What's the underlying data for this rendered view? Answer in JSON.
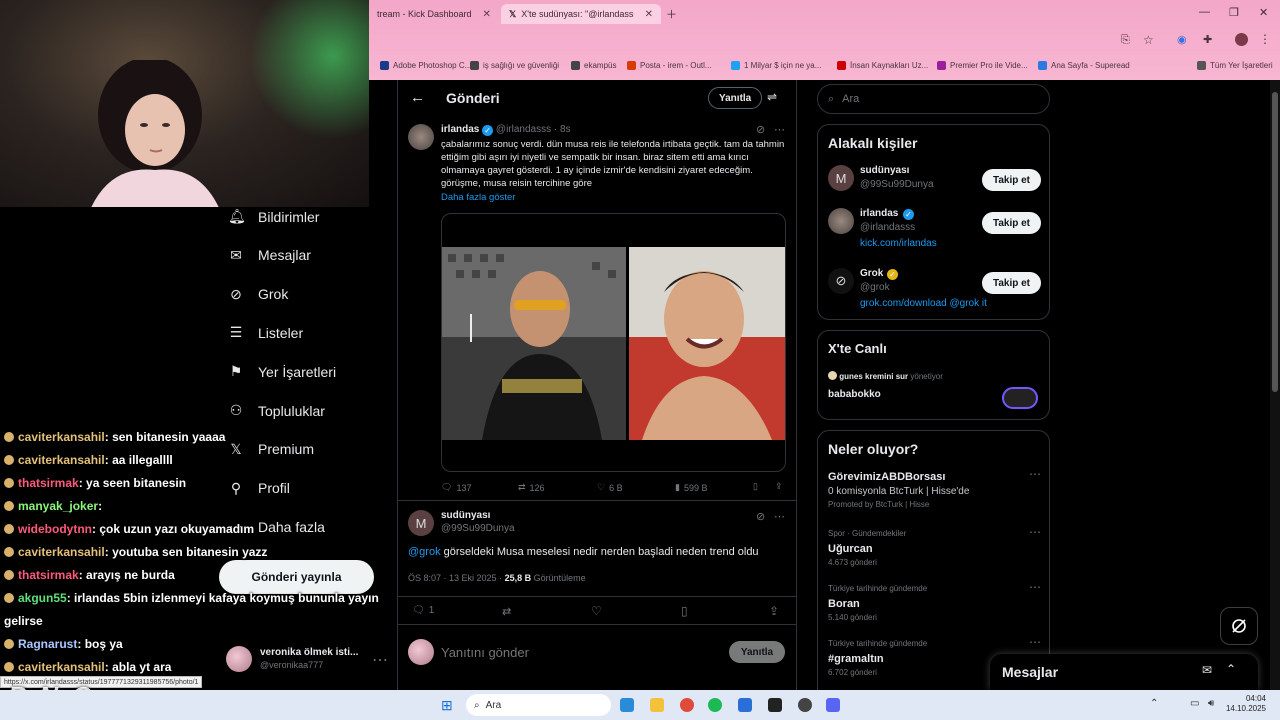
{
  "browser": {
    "tabs": [
      {
        "title": "tream - Kick Dashboard"
      },
      {
        "title": "X'te sudünyası: \"@irlandasss @..."
      }
    ],
    "bookmarks": [
      "Adobe Photoshop C...",
      "iş sağlığı ve güvenliği",
      "ekampüs",
      "Posta - irem - Outl...",
      "1 Milyar $ için ne ya...",
      "İnsan Kaynakları Uz...",
      "Premier Pro ile Vide...",
      "Ana Sayfa - Superead",
      "Tüm Yer İşaretleri"
    ],
    "bookmark_colors": [
      "#1a3a8a",
      "#444",
      "#444",
      "#d83b01",
      "#1da1f2",
      "#c00",
      "#9a1f9a",
      "#2a7ae2",
      "#555"
    ],
    "status_url": "https://x.com/irlandasss/status/1977771329311985756/photo/1"
  },
  "sidebar": {
    "items": [
      {
        "label": "Bildirimler",
        "icon": "bell-icon"
      },
      {
        "label": "Mesajlar",
        "icon": "mail-icon"
      },
      {
        "label": "Grok",
        "icon": "grok-icon"
      },
      {
        "label": "Listeler",
        "icon": "list-icon"
      },
      {
        "label": "Yer İşaretleri",
        "icon": "bookmark-icon"
      },
      {
        "label": "Topluluklar",
        "icon": "communities-icon"
      },
      {
        "label": "Premium",
        "icon": "x-logo-icon"
      },
      {
        "label": "Profil",
        "icon": "person-icon"
      },
      {
        "label": "Daha fazla",
        "icon": "more-circle-icon"
      }
    ],
    "post_button": "Gönderi yayınla",
    "account": {
      "name": "veronika ölmek isti...",
      "handle": "@veronikaa777"
    }
  },
  "chat": [
    {
      "user": "caviterkansahil",
      "message": "sen bitanesin yaaaa",
      "color": "#e4c07a"
    },
    {
      "user": "caviterkansahil",
      "message": "aa illegallll",
      "color": "#e4c07a"
    },
    {
      "user": "thatsirmak",
      "message": "ya seen bitanesin",
      "color": "#ff5a7a"
    },
    {
      "user": "manyak_joker",
      "message": "",
      "color": "#8cf57a"
    },
    {
      "user": "widebodytnn",
      "message": "çok uzun yazı okuyamadım",
      "color": "#ff5a7a"
    },
    {
      "user": "caviterkansahil",
      "message": "youtuba sen bitanesin yazz",
      "color": "#e4c07a"
    },
    {
      "user": "thatsirmak",
      "message": "arayış ne burda",
      "color": "#ff5a7a"
    },
    {
      "user": "akgun55",
      "message": "irlandas 5bin izlenmeyi kafaya koymuş bununla yayın",
      "color": "#5fe07a"
    },
    {
      "user": "",
      "message": "gelirse",
      "color": "#fff"
    },
    {
      "user": "Ragnarust",
      "message": "boş ya",
      "color": "#a9c8ff"
    },
    {
      "user": "caviterkansahil",
      "message": "abla yt ara",
      "color": "#e4c07a"
    }
  ],
  "watermark": "ByNoGame",
  "main": {
    "header_title": "Gönderi",
    "reply_pill": "Yanıtla",
    "post": {
      "name": "irlandas",
      "handle": "@irlandasss",
      "time": "· 8s",
      "text": "çabalarımız sonuç verdi. dün musa reis ile telefonda irtibata geçtik. tam da tahmin ettiğim gibi aşırı iyi niyetli ve sempatik bir insan. biraz sitem etti ama kırıcı olmamaya gayret gösterdi. 1 ay içinde izmir'de kendisini ziyaret edeceğim. görüşme, musa reisin tercihine göre",
      "show_more": "Daha fazla göster",
      "stats": {
        "replies": "137",
        "reposts": "126",
        "likes": "6 B",
        "views": "599 B"
      }
    },
    "reply": {
      "name": "sudünyası",
      "handle": "@99Su99Dunya",
      "mention": "@grok",
      "text": " görseldeki Musa meselesi nedir nerden başladi neden trend oldu",
      "time": "ÖS 8:07 · 13 Eki 2025 · ",
      "views": "25,8 B",
      "views_label": " Görüntüleme",
      "reply_count": "1"
    },
    "compose": {
      "placeholder": "Yanıtını gönder",
      "button": "Yanıtla"
    }
  },
  "right": {
    "search_placeholder": "Ara",
    "relevant": {
      "title": "Alakalı kişiler",
      "people": [
        {
          "name": "sudünyası",
          "handle": "@99Su99Dunya",
          "bio": "",
          "follow": "Takip et"
        },
        {
          "name": "irlandas",
          "handle": "@irlandasss",
          "bio": "kick.com/irlandas",
          "follow": "Takip et"
        },
        {
          "name": "Grok",
          "handle": "@grok",
          "bio": "grok.com/download @grok it",
          "follow": "Takip et"
        }
      ]
    },
    "live": {
      "title": "X'te Canlı",
      "host": "gunes kremini sur",
      "host_suffix": "yönetiyor",
      "space": "bababokko"
    },
    "trends": {
      "title": "Neler oluyor?",
      "items": [
        {
          "category": "",
          "name": "GörevimizABDBorsası",
          "count": "0 komisyonla BtcTurk | Hisse'de",
          "extra": "Promoted by BtcTurk | Hisse"
        },
        {
          "category": "Spor · Gündemdekiler",
          "name": "Uğurcan",
          "count": "4.673 gönderi",
          "extra": ""
        },
        {
          "category": "Türkiye tarihinde gündemde",
          "name": "Boran",
          "count": "5.140 gönderi",
          "extra": ""
        },
        {
          "category": "Türkiye tarihinde gündemde",
          "name": "#gramaltın",
          "count": "6.702 gönderi",
          "extra": ""
        }
      ]
    },
    "messages_drawer": "Mesajlar"
  },
  "taskbar": {
    "search": "Ara",
    "time": "04:04",
    "date": "14.10.2025"
  }
}
